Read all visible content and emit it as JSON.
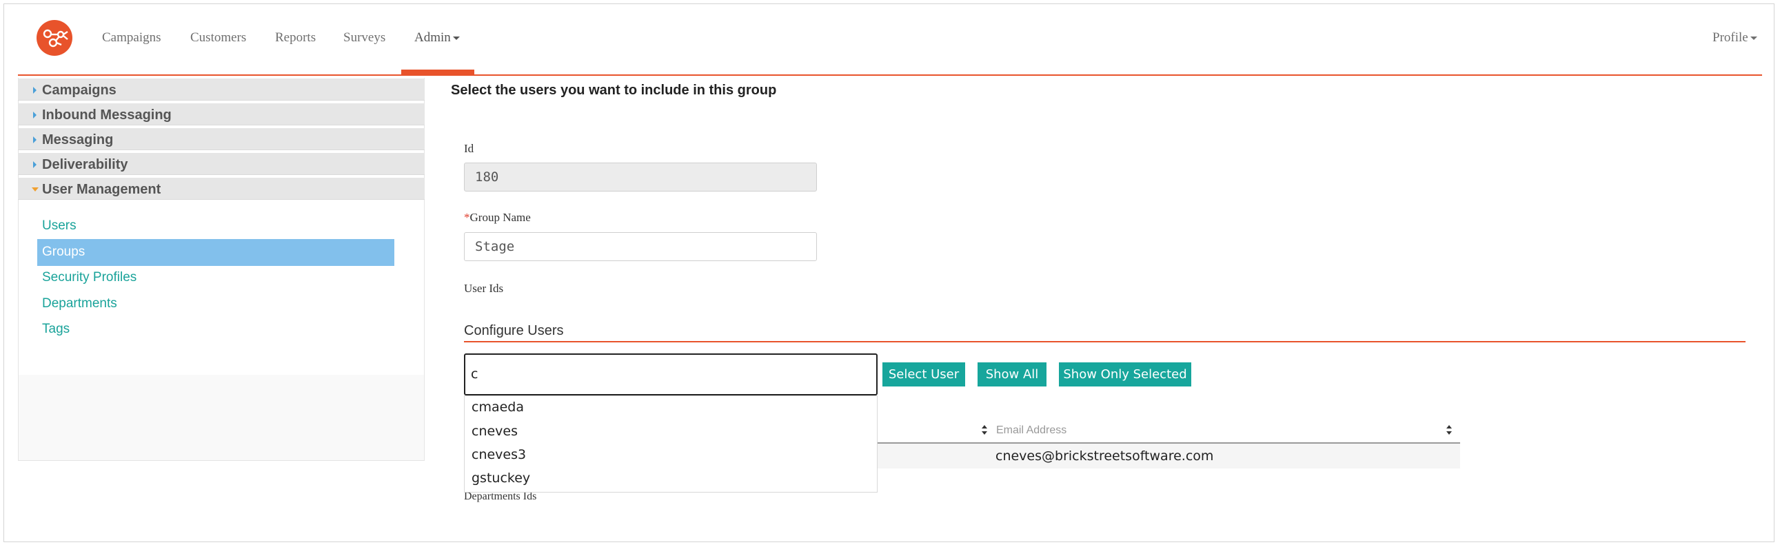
{
  "nav": {
    "items": [
      {
        "label": "Campaigns"
      },
      {
        "label": "Customers"
      },
      {
        "label": "Reports"
      },
      {
        "label": "Surveys"
      },
      {
        "label": "Admin"
      }
    ],
    "active": "Admin",
    "profile_label": "Profile"
  },
  "sidebar": {
    "sections": [
      {
        "label": "Campaigns",
        "expanded": false
      },
      {
        "label": "Inbound Messaging",
        "expanded": false
      },
      {
        "label": "Messaging",
        "expanded": false
      },
      {
        "label": "Deliverability",
        "expanded": false
      },
      {
        "label": "User Management",
        "expanded": true
      }
    ],
    "sub_items": [
      {
        "label": "Users"
      },
      {
        "label": "Groups",
        "selected": true
      },
      {
        "label": "Security Profiles"
      },
      {
        "label": "Departments"
      },
      {
        "label": "Tags"
      }
    ]
  },
  "main": {
    "title": "Select the users you want to include in this group",
    "id_label": "Id",
    "id_value": "180",
    "group_name_required": "*",
    "group_name_label": "Group Name",
    "group_name_value": "Stage",
    "user_ids_label": "User Ids",
    "configure_label": "Configure Users",
    "search_value": "c",
    "buttons": {
      "select_user": "Select User",
      "show_all": "Show All",
      "show_only_selected": "Show Only Selected"
    },
    "table": {
      "columns": [
        "",
        "Email Address"
      ],
      "rows": [
        [
          "",
          "cneves@brickstreetsoftware.com"
        ]
      ]
    },
    "autocomplete": [
      "cmaeda",
      "cneves",
      "cneves3",
      "gstuckey"
    ],
    "departments_label": "Departments Ids"
  },
  "colors": {
    "accent": "#e8532b",
    "teal": "#17a69c",
    "selected_bg": "#82c0ec",
    "link": "#1aa39a"
  }
}
